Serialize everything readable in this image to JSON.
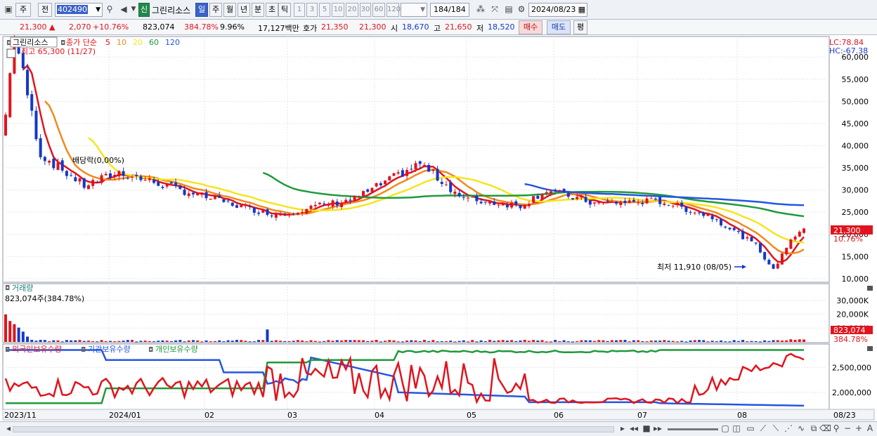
{
  "toolbar": {
    "period_label": "주",
    "prev_label": "전",
    "code": "402490",
    "new_badge": "신",
    "stock_name": "그린리소스",
    "intervals": [
      "일",
      "주",
      "월",
      "년",
      "분",
      "초",
      "틱"
    ],
    "numbers": [
      "1",
      "3",
      "5",
      "10",
      "20",
      "30",
      "60",
      "120"
    ],
    "count": "184",
    "count_total": "/184",
    "date": "2024/08/23"
  },
  "quote": {
    "price": "21,300",
    "change": "2,070",
    "change_pct": "+10.76%",
    "volume": "823,074",
    "volume_pct": "384.78%",
    "turnover": "9.96%",
    "amount": "17,127백만",
    "bid_label": "호가",
    "ask": "21,350",
    "bid": "21,300",
    "open_label": "시",
    "open": "18,670",
    "high_label": "고",
    "high": "21,650",
    "low_label": "저",
    "low": "18,520",
    "buy_label": "매수",
    "sell_label": "매도",
    "eval_label": "평"
  },
  "price_panel": {
    "name": "그린리소스",
    "ma_label": "종가 단순",
    "ma_periods": [
      "5",
      "10",
      "20",
      "60",
      "120"
    ],
    "ma_colors": [
      "#e0141e",
      "#f08a1c",
      "#f5e51e",
      "#1f9a3a",
      "#2456e0"
    ],
    "high_note": "최고 65,300 (11/27)",
    "low_note": "최저 11,910 (08/05)",
    "dividend_note": "배당락(0,00%)",
    "lc": "LC:78.84",
    "hc": "HC:-67.38",
    "y_ticks": [
      "60,000",
      "55,000",
      "50,000",
      "45,000",
      "40,000",
      "35,000",
      "30,000",
      "25,000",
      "20,000",
      "15,000",
      "10,000"
    ],
    "last_price_tag": "21,300",
    "last_pct_tag": "10.76%"
  },
  "volume_panel": {
    "title": "거래량",
    "value": "823,074주(384.78%)",
    "y_ticks": [
      "30,000K",
      "20,000K",
      "10,000K"
    ],
    "last_tag": "823,074",
    "last_pct_tag": "384.78%"
  },
  "holding_panel": {
    "series": [
      "외국인보유수량",
      "기관보유수량",
      "개인보유수량"
    ],
    "series_colors": [
      "#e0141e",
      "#2456e0",
      "#1f9a3a"
    ],
    "y_ticks": [
      "2,500,000",
      "2,000,000"
    ]
  },
  "x_axis": [
    "2023/11",
    "2024/01",
    "02",
    "03",
    "04",
    "05",
    "06",
    "07",
    "08",
    "08/23"
  ],
  "chart_data": {
    "type": "candlestick",
    "x": [
      "2023-11",
      "2023-12",
      "2024-01",
      "2024-02",
      "2024-03",
      "2024-04",
      "2024-05",
      "2024-06",
      "2024-07",
      "2024-08"
    ],
    "close_trend": [
      44000,
      33000,
      31500,
      25000,
      33500,
      27000,
      27000,
      26500,
      18000,
      21300
    ],
    "ylim": [
      9500,
      64000
    ],
    "high": 65300,
    "low": 11910,
    "last_close": 21300
  }
}
